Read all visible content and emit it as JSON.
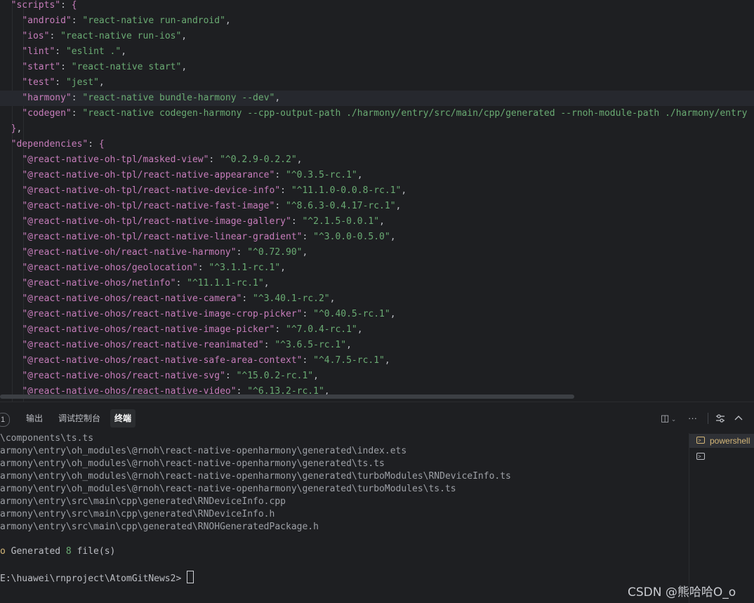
{
  "editor": {
    "lines": [
      {
        "parts": [
          [
            "  ",
            "pun"
          ],
          [
            "\"scripts\"",
            "key"
          ],
          [
            ": ",
            "pun"
          ],
          [
            "{",
            "brace"
          ]
        ]
      },
      {
        "parts": [
          [
            "    ",
            "pun"
          ],
          [
            "\"android\"",
            "key"
          ],
          [
            ": ",
            "pun"
          ],
          [
            "\"react-native run-android\"",
            "str"
          ],
          [
            ",",
            "pun"
          ]
        ]
      },
      {
        "parts": [
          [
            "    ",
            "pun"
          ],
          [
            "\"ios\"",
            "key"
          ],
          [
            ": ",
            "pun"
          ],
          [
            "\"react-native run-ios\"",
            "str"
          ],
          [
            ",",
            "pun"
          ]
        ]
      },
      {
        "parts": [
          [
            "    ",
            "pun"
          ],
          [
            "\"lint\"",
            "key"
          ],
          [
            ": ",
            "pun"
          ],
          [
            "\"eslint .\"",
            "str"
          ],
          [
            ",",
            "pun"
          ]
        ]
      },
      {
        "parts": [
          [
            "    ",
            "pun"
          ],
          [
            "\"start\"",
            "key"
          ],
          [
            ": ",
            "pun"
          ],
          [
            "\"react-native start\"",
            "str"
          ],
          [
            ",",
            "pun"
          ]
        ]
      },
      {
        "parts": [
          [
            "    ",
            "pun"
          ],
          [
            "\"test\"",
            "key"
          ],
          [
            ": ",
            "pun"
          ],
          [
            "\"jest\"",
            "str"
          ],
          [
            ",",
            "pun"
          ]
        ]
      },
      {
        "parts": [
          [
            "    ",
            "pun"
          ],
          [
            "\"harmony\"",
            "key"
          ],
          [
            ": ",
            "pun"
          ],
          [
            "\"react-native bundle-harmony --dev\"",
            "str"
          ],
          [
            ",",
            "pun"
          ]
        ],
        "active": true
      },
      {
        "parts": [
          [
            "    ",
            "pun"
          ],
          [
            "\"codegen\"",
            "key"
          ],
          [
            ": ",
            "pun"
          ],
          [
            "\"react-native codegen-harmony --cpp-output-path ./harmony/entry/src/main/cpp/generated --rnoh-module-path ./harmony/entry",
            "str"
          ]
        ]
      },
      {
        "parts": [
          [
            "  ",
            "pun"
          ],
          [
            "}",
            "brace"
          ],
          [
            ",",
            "pun"
          ]
        ]
      },
      {
        "parts": [
          [
            "  ",
            "pun"
          ],
          [
            "\"dependencies\"",
            "key"
          ],
          [
            ": ",
            "pun"
          ],
          [
            "{",
            "brace"
          ]
        ]
      },
      {
        "parts": [
          [
            "    ",
            "pun"
          ],
          [
            "\"@react-native-oh-tpl/masked-view\"",
            "key"
          ],
          [
            ": ",
            "pun"
          ],
          [
            "\"^0.2.9-0.2.2\"",
            "str"
          ],
          [
            ",",
            "pun"
          ]
        ]
      },
      {
        "parts": [
          [
            "    ",
            "pun"
          ],
          [
            "\"@react-native-oh-tpl/react-native-appearance\"",
            "key"
          ],
          [
            ": ",
            "pun"
          ],
          [
            "\"^0.3.5-rc.1\"",
            "str"
          ],
          [
            ",",
            "pun"
          ]
        ]
      },
      {
        "parts": [
          [
            "    ",
            "pun"
          ],
          [
            "\"@react-native-oh-tpl/react-native-device-info\"",
            "key"
          ],
          [
            ": ",
            "pun"
          ],
          [
            "\"^11.1.0-0.0.8-rc.1\"",
            "str"
          ],
          [
            ",",
            "pun"
          ]
        ]
      },
      {
        "parts": [
          [
            "    ",
            "pun"
          ],
          [
            "\"@react-native-oh-tpl/react-native-fast-image\"",
            "key"
          ],
          [
            ": ",
            "pun"
          ],
          [
            "\"^8.6.3-0.4.17-rc.1\"",
            "str"
          ],
          [
            ",",
            "pun"
          ]
        ]
      },
      {
        "parts": [
          [
            "    ",
            "pun"
          ],
          [
            "\"@react-native-oh-tpl/react-native-image-gallery\"",
            "key"
          ],
          [
            ": ",
            "pun"
          ],
          [
            "\"^2.1.5-0.0.1\"",
            "str"
          ],
          [
            ",",
            "pun"
          ]
        ]
      },
      {
        "parts": [
          [
            "    ",
            "pun"
          ],
          [
            "\"@react-native-oh-tpl/react-native-linear-gradient\"",
            "key"
          ],
          [
            ": ",
            "pun"
          ],
          [
            "\"^3.0.0-0.5.0\"",
            "str"
          ],
          [
            ",",
            "pun"
          ]
        ]
      },
      {
        "parts": [
          [
            "    ",
            "pun"
          ],
          [
            "\"@react-native-oh/react-native-harmony\"",
            "key"
          ],
          [
            ": ",
            "pun"
          ],
          [
            "\"^0.72.90\"",
            "str"
          ],
          [
            ",",
            "pun"
          ]
        ]
      },
      {
        "parts": [
          [
            "    ",
            "pun"
          ],
          [
            "\"@react-native-ohos/geolocation\"",
            "key"
          ],
          [
            ": ",
            "pun"
          ],
          [
            "\"^3.1.1-rc.1\"",
            "str"
          ],
          [
            ",",
            "pun"
          ]
        ]
      },
      {
        "parts": [
          [
            "    ",
            "pun"
          ],
          [
            "\"@react-native-ohos/netinfo\"",
            "key"
          ],
          [
            ": ",
            "pun"
          ],
          [
            "\"^11.1.1-rc.1\"",
            "str"
          ],
          [
            ",",
            "pun"
          ]
        ]
      },
      {
        "parts": [
          [
            "    ",
            "pun"
          ],
          [
            "\"@react-native-ohos/react-native-camera\"",
            "key"
          ],
          [
            ": ",
            "pun"
          ],
          [
            "\"^3.40.1-rc.2\"",
            "str"
          ],
          [
            ",",
            "pun"
          ]
        ]
      },
      {
        "parts": [
          [
            "    ",
            "pun"
          ],
          [
            "\"@react-native-ohos/react-native-image-crop-picker\"",
            "key"
          ],
          [
            ": ",
            "pun"
          ],
          [
            "\"^0.40.5-rc.1\"",
            "str"
          ],
          [
            ",",
            "pun"
          ]
        ]
      },
      {
        "parts": [
          [
            "    ",
            "pun"
          ],
          [
            "\"@react-native-ohos/react-native-image-picker\"",
            "key"
          ],
          [
            ": ",
            "pun"
          ],
          [
            "\"^7.0.4-rc.1\"",
            "str"
          ],
          [
            ",",
            "pun"
          ]
        ]
      },
      {
        "parts": [
          [
            "    ",
            "pun"
          ],
          [
            "\"@react-native-ohos/react-native-reanimated\"",
            "key"
          ],
          [
            ": ",
            "pun"
          ],
          [
            "\"^3.6.5-rc.1\"",
            "str"
          ],
          [
            ",",
            "pun"
          ]
        ]
      },
      {
        "parts": [
          [
            "    ",
            "pun"
          ],
          [
            "\"@react-native-ohos/react-native-safe-area-context\"",
            "key"
          ],
          [
            ": ",
            "pun"
          ],
          [
            "\"^4.7.5-rc.1\"",
            "str"
          ],
          [
            ",",
            "pun"
          ]
        ]
      },
      {
        "parts": [
          [
            "    ",
            "pun"
          ],
          [
            "\"@react-native-ohos/react-native-svg\"",
            "key"
          ],
          [
            ": ",
            "pun"
          ],
          [
            "\"^15.0.2-rc.1\"",
            "str"
          ],
          [
            ",",
            "pun"
          ]
        ]
      },
      {
        "parts": [
          [
            "    ",
            "pun"
          ],
          [
            "\"@react-native-ohos/react-native-video\"",
            "key"
          ],
          [
            ": ",
            "pun"
          ],
          [
            "\"^6.13.2-rc.1\"",
            "str"
          ],
          [
            ",",
            "pun"
          ]
        ]
      }
    ]
  },
  "panel": {
    "problems_count": "1",
    "tabs": [
      {
        "label": "输出",
        "active": false
      },
      {
        "label": "调试控制台",
        "active": false
      },
      {
        "label": "终端",
        "active": true
      }
    ],
    "toolbar_icons": [
      "split-terminal-icon",
      "more-actions-icon",
      "settings-icon",
      "maximize-icon"
    ]
  },
  "terminal": {
    "lines": [
      "\\components\\ts.ts",
      "armony\\entry\\oh_modules\\@rnoh\\react-native-openharmony\\generated\\index.ets",
      "armony\\entry\\oh_modules\\@rnoh\\react-native-openharmony\\generated\\ts.ts",
      "armony\\entry\\oh_modules\\@rnoh\\react-native-openharmony\\generated\\turboModules\\RNDeviceInfo.ts",
      "armony\\entry\\oh_modules\\@rnoh\\react-native-openharmony\\generated\\turboModules\\ts.ts",
      "armony\\entry\\src\\main\\cpp\\generated\\RNDeviceInfo.cpp",
      "armony\\entry\\src\\main\\cpp\\generated\\RNDeviceInfo.h",
      "armony\\entry\\src\\main\\cpp\\generated\\RNOHGeneratedPackage.h"
    ],
    "summary_prefix": "o",
    "summary_text1": " Generated ",
    "summary_count": "8",
    "summary_text2": " file(s)",
    "prompt": "E:\\huawei\\rnproject\\AtomGitNews2> "
  },
  "terminal_list": {
    "items": [
      {
        "label": "powershell",
        "selected": true
      },
      {
        "label": "",
        "selected": false
      }
    ]
  },
  "watermark": "CSDN @熊哈哈O_o"
}
